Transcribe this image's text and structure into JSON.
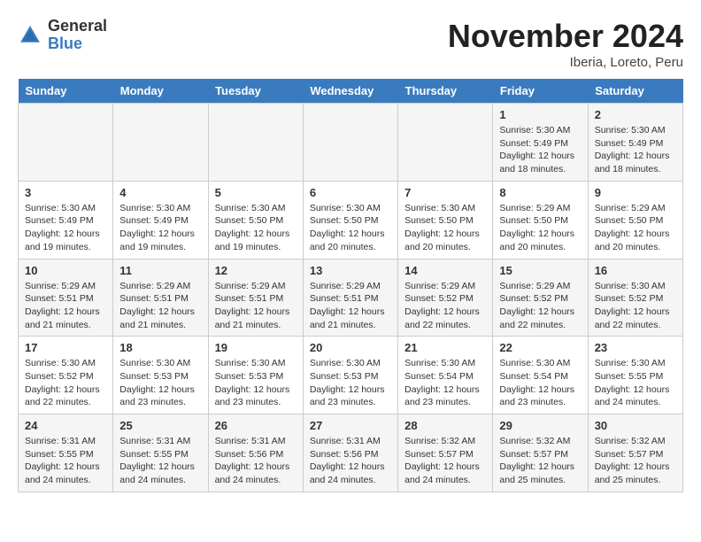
{
  "header": {
    "logo_general": "General",
    "logo_blue": "Blue",
    "month_title": "November 2024",
    "location": "Iberia, Loreto, Peru"
  },
  "weekdays": [
    "Sunday",
    "Monday",
    "Tuesday",
    "Wednesday",
    "Thursday",
    "Friday",
    "Saturday"
  ],
  "weeks": [
    [
      {
        "day": "",
        "info": ""
      },
      {
        "day": "",
        "info": ""
      },
      {
        "day": "",
        "info": ""
      },
      {
        "day": "",
        "info": ""
      },
      {
        "day": "",
        "info": ""
      },
      {
        "day": "1",
        "info": "Sunrise: 5:30 AM\nSunset: 5:49 PM\nDaylight: 12 hours and 18 minutes."
      },
      {
        "day": "2",
        "info": "Sunrise: 5:30 AM\nSunset: 5:49 PM\nDaylight: 12 hours and 18 minutes."
      }
    ],
    [
      {
        "day": "3",
        "info": "Sunrise: 5:30 AM\nSunset: 5:49 PM\nDaylight: 12 hours and 19 minutes."
      },
      {
        "day": "4",
        "info": "Sunrise: 5:30 AM\nSunset: 5:49 PM\nDaylight: 12 hours and 19 minutes."
      },
      {
        "day": "5",
        "info": "Sunrise: 5:30 AM\nSunset: 5:50 PM\nDaylight: 12 hours and 19 minutes."
      },
      {
        "day": "6",
        "info": "Sunrise: 5:30 AM\nSunset: 5:50 PM\nDaylight: 12 hours and 20 minutes."
      },
      {
        "day": "7",
        "info": "Sunrise: 5:30 AM\nSunset: 5:50 PM\nDaylight: 12 hours and 20 minutes."
      },
      {
        "day": "8",
        "info": "Sunrise: 5:29 AM\nSunset: 5:50 PM\nDaylight: 12 hours and 20 minutes."
      },
      {
        "day": "9",
        "info": "Sunrise: 5:29 AM\nSunset: 5:50 PM\nDaylight: 12 hours and 20 minutes."
      }
    ],
    [
      {
        "day": "10",
        "info": "Sunrise: 5:29 AM\nSunset: 5:51 PM\nDaylight: 12 hours and 21 minutes."
      },
      {
        "day": "11",
        "info": "Sunrise: 5:29 AM\nSunset: 5:51 PM\nDaylight: 12 hours and 21 minutes."
      },
      {
        "day": "12",
        "info": "Sunrise: 5:29 AM\nSunset: 5:51 PM\nDaylight: 12 hours and 21 minutes."
      },
      {
        "day": "13",
        "info": "Sunrise: 5:29 AM\nSunset: 5:51 PM\nDaylight: 12 hours and 21 minutes."
      },
      {
        "day": "14",
        "info": "Sunrise: 5:29 AM\nSunset: 5:52 PM\nDaylight: 12 hours and 22 minutes."
      },
      {
        "day": "15",
        "info": "Sunrise: 5:29 AM\nSunset: 5:52 PM\nDaylight: 12 hours and 22 minutes."
      },
      {
        "day": "16",
        "info": "Sunrise: 5:30 AM\nSunset: 5:52 PM\nDaylight: 12 hours and 22 minutes."
      }
    ],
    [
      {
        "day": "17",
        "info": "Sunrise: 5:30 AM\nSunset: 5:52 PM\nDaylight: 12 hours and 22 minutes."
      },
      {
        "day": "18",
        "info": "Sunrise: 5:30 AM\nSunset: 5:53 PM\nDaylight: 12 hours and 23 minutes."
      },
      {
        "day": "19",
        "info": "Sunrise: 5:30 AM\nSunset: 5:53 PM\nDaylight: 12 hours and 23 minutes."
      },
      {
        "day": "20",
        "info": "Sunrise: 5:30 AM\nSunset: 5:53 PM\nDaylight: 12 hours and 23 minutes."
      },
      {
        "day": "21",
        "info": "Sunrise: 5:30 AM\nSunset: 5:54 PM\nDaylight: 12 hours and 23 minutes."
      },
      {
        "day": "22",
        "info": "Sunrise: 5:30 AM\nSunset: 5:54 PM\nDaylight: 12 hours and 23 minutes."
      },
      {
        "day": "23",
        "info": "Sunrise: 5:30 AM\nSunset: 5:55 PM\nDaylight: 12 hours and 24 minutes."
      }
    ],
    [
      {
        "day": "24",
        "info": "Sunrise: 5:31 AM\nSunset: 5:55 PM\nDaylight: 12 hours and 24 minutes."
      },
      {
        "day": "25",
        "info": "Sunrise: 5:31 AM\nSunset: 5:55 PM\nDaylight: 12 hours and 24 minutes."
      },
      {
        "day": "26",
        "info": "Sunrise: 5:31 AM\nSunset: 5:56 PM\nDaylight: 12 hours and 24 minutes."
      },
      {
        "day": "27",
        "info": "Sunrise: 5:31 AM\nSunset: 5:56 PM\nDaylight: 12 hours and 24 minutes."
      },
      {
        "day": "28",
        "info": "Sunrise: 5:32 AM\nSunset: 5:57 PM\nDaylight: 12 hours and 24 minutes."
      },
      {
        "day": "29",
        "info": "Sunrise: 5:32 AM\nSunset: 5:57 PM\nDaylight: 12 hours and 25 minutes."
      },
      {
        "day": "30",
        "info": "Sunrise: 5:32 AM\nSunset: 5:57 PM\nDaylight: 12 hours and 25 minutes."
      }
    ]
  ]
}
